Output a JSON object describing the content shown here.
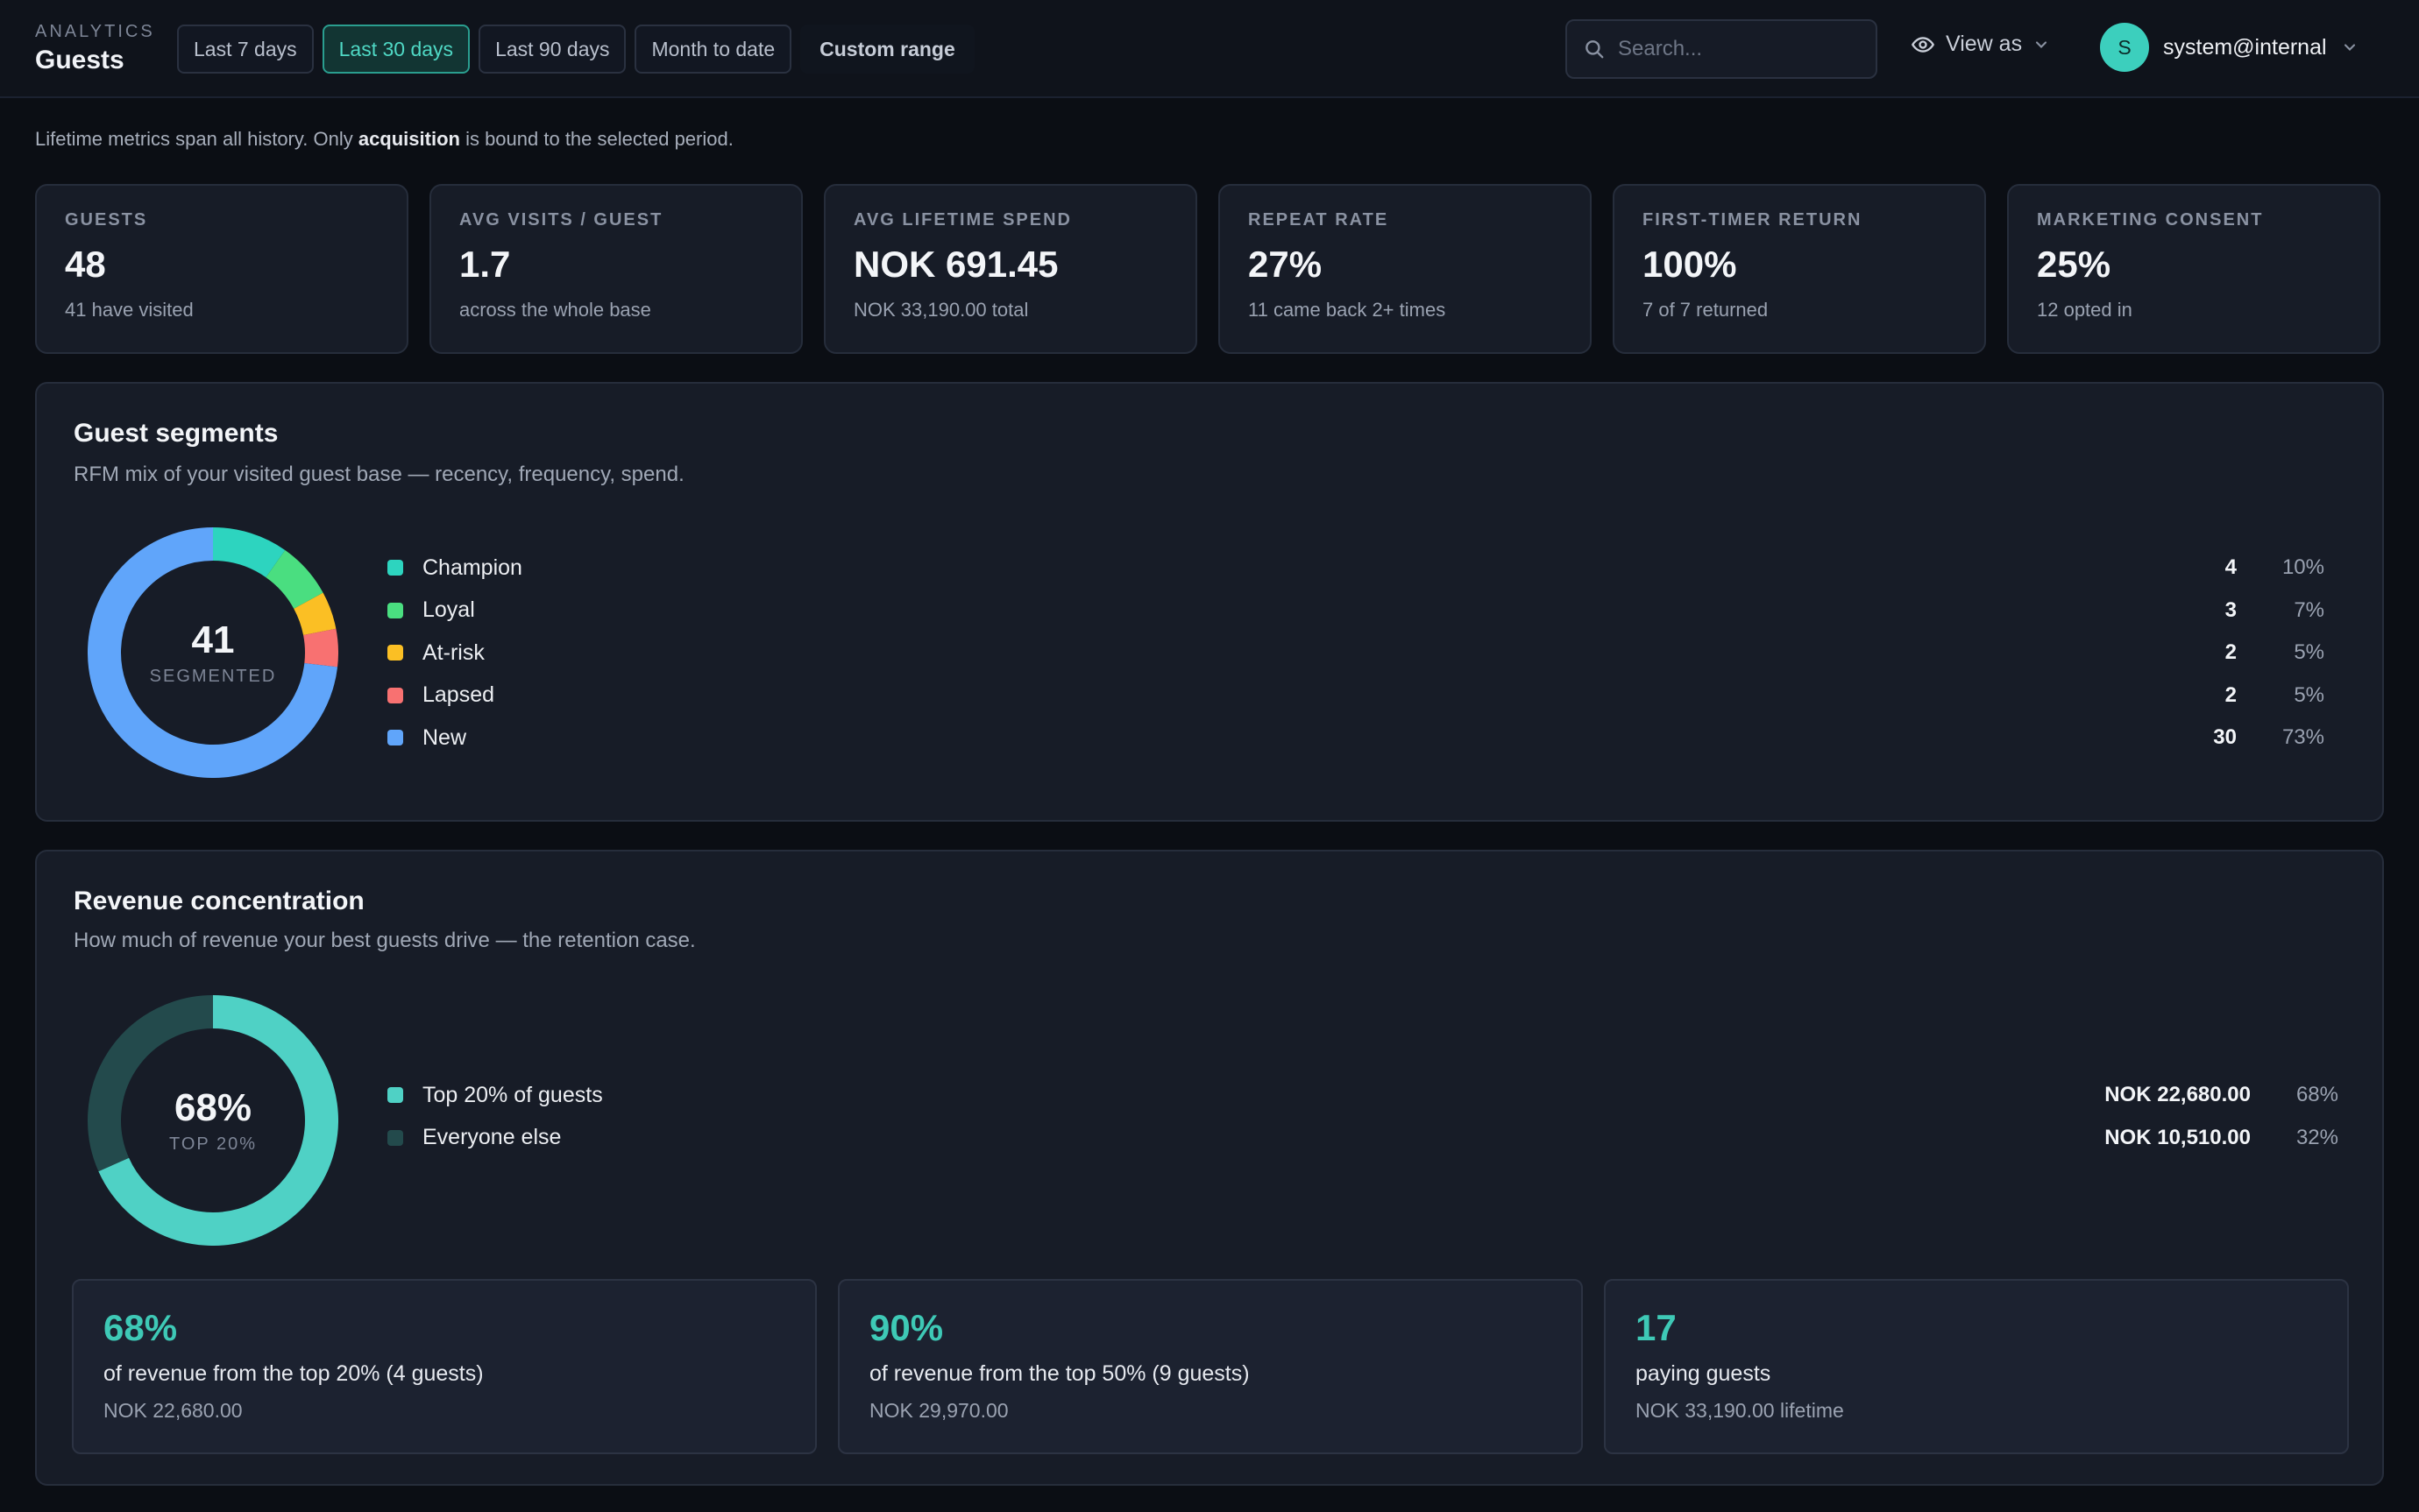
{
  "header": {
    "kicker": "ANALYTICS",
    "title": "Guests",
    "ranges": [
      "Last 7 days",
      "Last 30 days",
      "Last 90 days",
      "Month to date"
    ],
    "active_range": "Last 30 days",
    "custom_range": "Custom range",
    "search_placeholder": "Search...",
    "view_as": "View as",
    "user_initial": "S",
    "user_email": "system@internal"
  },
  "intro": {
    "prefix": "Lifetime metrics span all history. Only ",
    "bold": "acquisition",
    "suffix": " is bound to the selected period."
  },
  "kpis": [
    {
      "label": "GUESTS",
      "value": "48",
      "sub": "41 have visited"
    },
    {
      "label": "AVG VISITS / GUEST",
      "value": "1.7",
      "sub": "across the whole base"
    },
    {
      "label": "AVG LIFETIME SPEND",
      "value": "NOK 691.45",
      "sub": "NOK 33,190.00 total"
    },
    {
      "label": "REPEAT RATE",
      "value": "27%",
      "sub": "11 came back 2+ times"
    },
    {
      "label": "FIRST-TIMER RETURN",
      "value": "100%",
      "sub": "7 of 7 returned"
    },
    {
      "label": "MARKETING CONSENT",
      "value": "25%",
      "sub": "12 opted in"
    }
  ],
  "segments": {
    "title": "Guest segments",
    "description": "RFM mix of your visited guest base — recency, frequency, spend.",
    "center_value": "41",
    "center_label": "SEGMENTED",
    "items": [
      {
        "label": "Champion",
        "count": "4",
        "pct": "10%",
        "value": 4,
        "color": "#2dd4bf"
      },
      {
        "label": "Loyal",
        "count": "3",
        "pct": "7%",
        "value": 3,
        "color": "#4ade80"
      },
      {
        "label": "At-risk",
        "count": "2",
        "pct": "5%",
        "value": 2,
        "color": "#fbbf24"
      },
      {
        "label": "Lapsed",
        "count": "2",
        "pct": "5%",
        "value": 2,
        "color": "#f87171"
      },
      {
        "label": "New",
        "count": "30",
        "pct": "73%",
        "value": 30,
        "color": "#60a5fa"
      }
    ]
  },
  "revenue": {
    "title": "Revenue concentration",
    "description": "How much of revenue your best guests drive — the retention case.",
    "center_value": "68%",
    "center_label": "TOP 20%",
    "items": [
      {
        "label": "Top 20% of guests",
        "amount": "NOK 22,680.00",
        "pct": "68%",
        "value": 22680,
        "color": "#4fd1c5"
      },
      {
        "label": "Everyone else",
        "amount": "NOK 10,510.00",
        "pct": "32%",
        "value": 10510,
        "color": "#234a4c"
      }
    ],
    "cards": [
      {
        "value": "68%",
        "desc": "of revenue from the top 20% (4 guests)",
        "sub": "NOK 22,680.00"
      },
      {
        "value": "90%",
        "desc": "of revenue from the top 50% (9 guests)",
        "sub": "NOK 29,970.00"
      },
      {
        "value": "17",
        "desc": "paying guests",
        "sub": "NOK 33,190.00 lifetime"
      }
    ]
  }
}
